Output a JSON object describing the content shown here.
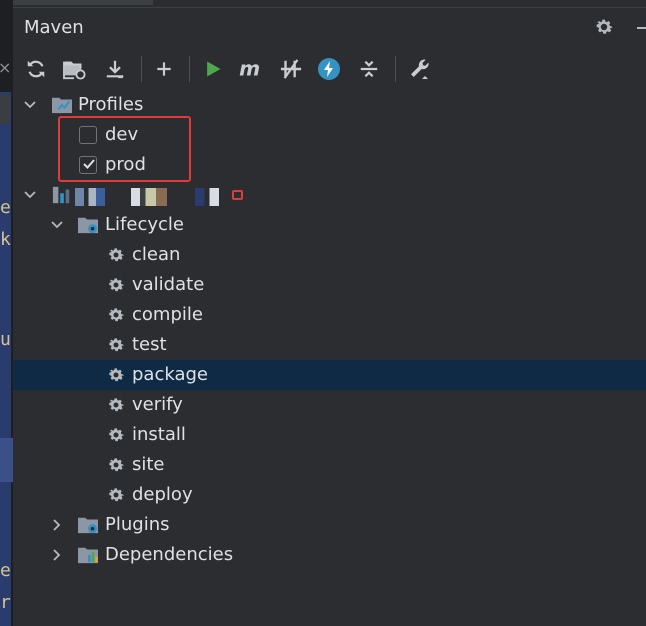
{
  "panel": {
    "title": "Maven"
  },
  "toolbar": {
    "buttons": [
      {
        "icon": "reload-icon"
      },
      {
        "icon": "generate-sources-icon"
      },
      {
        "icon": "download-icon"
      },
      {
        "icon": "add-icon"
      },
      {
        "icon": "run-icon"
      },
      {
        "icon": "execute-goal-icon"
      },
      {
        "icon": "skip-tests-icon"
      },
      {
        "icon": "offline-icon"
      },
      {
        "icon": "collapse-all-icon"
      },
      {
        "icon": "settings-wrench-icon"
      }
    ]
  },
  "tree": {
    "profiles_label": "Profiles",
    "profiles": [
      {
        "label": "dev",
        "checked": false
      },
      {
        "label": "prod",
        "checked": true
      }
    ],
    "lifecycle_label": "Lifecycle",
    "lifecycle": [
      "clean",
      "validate",
      "compile",
      "test",
      "package",
      "verify",
      "install",
      "site",
      "deploy"
    ],
    "selected_goal": "package",
    "plugins_label": "Plugins",
    "dependencies_label": "Dependencies"
  },
  "editor_fragments": [
    "e",
    "k",
    "u",
    "e",
    "r"
  ],
  "colors": {
    "background": "#2b2d30",
    "selection": "#0e2a44",
    "highlight_border": "#e03a3a",
    "run_green": "#4fa84f",
    "offline_blue": "#3592c4"
  }
}
